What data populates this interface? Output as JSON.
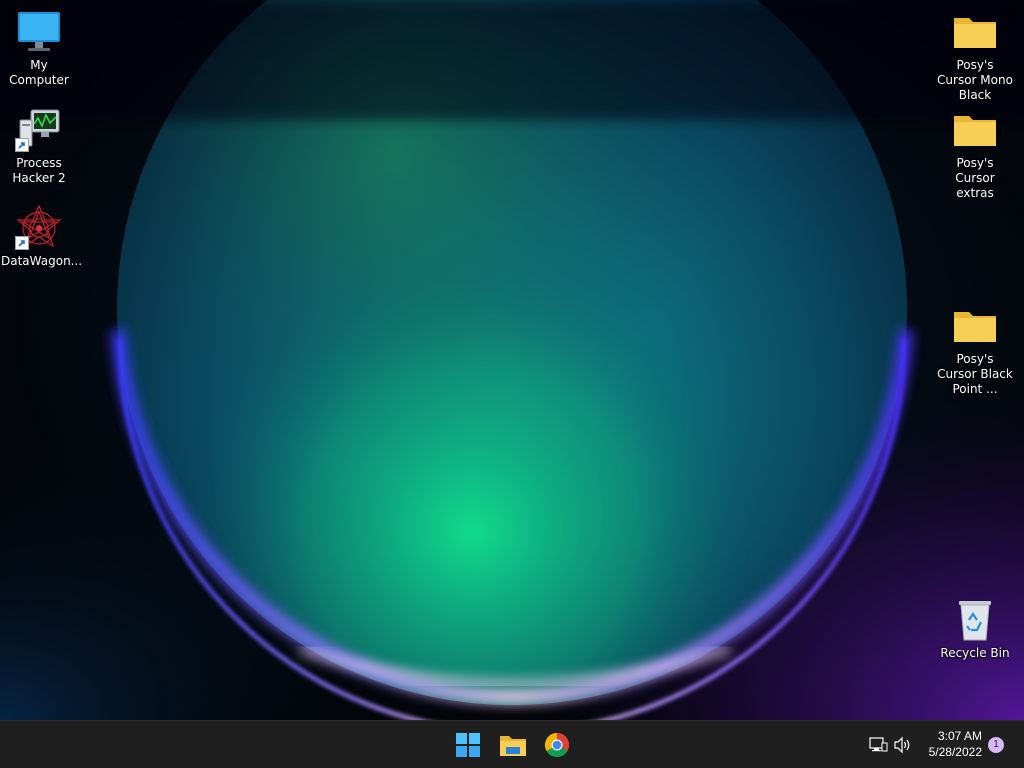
{
  "desktop": {
    "icons_left": [
      {
        "label": "My Computer",
        "icon": "monitor-icon"
      },
      {
        "label": "Process Hacker 2",
        "icon": "process-hacker-icon",
        "shortcut": true
      },
      {
        "label": "DataWagon...",
        "icon": "datawagon-icon",
        "shortcut": true
      }
    ],
    "icons_right": [
      {
        "label": "Posy's Cursor Mono Black",
        "icon": "folder-icon"
      },
      {
        "label": "Posy's Cursor extras",
        "icon": "folder-icon"
      },
      {
        "label": "Posy's Cursor Black Point ...",
        "icon": "folder-icon"
      },
      {
        "label": "Recycle Bin",
        "icon": "recycle-bin-icon"
      }
    ]
  },
  "taskbar": {
    "pinned": [
      {
        "name": "start",
        "icon": "windows-logo-icon"
      },
      {
        "name": "file-explorer",
        "icon": "file-explorer-icon"
      },
      {
        "name": "chrome",
        "icon": "chrome-icon"
      }
    ],
    "tray": {
      "network_icon": "network-icon",
      "volume_icon": "volume-icon"
    },
    "clock": {
      "time": "3:07 AM",
      "date": "5/28/2022"
    },
    "notification_count": "1"
  },
  "colors": {
    "taskbar_bg": "#1f1f20",
    "folder_yellow": "#f8cf55",
    "accent_blue": "#4cc2ff"
  }
}
